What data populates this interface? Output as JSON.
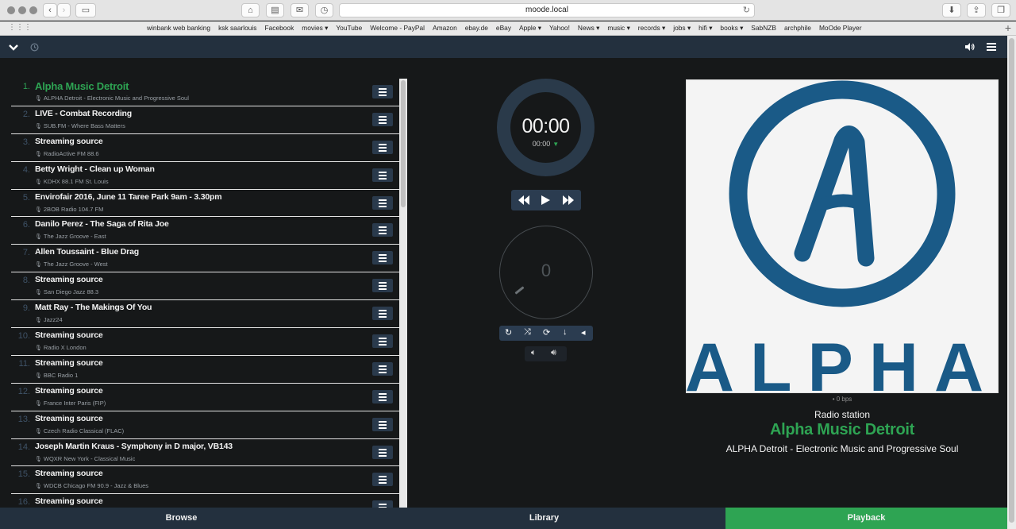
{
  "browser": {
    "url": "moode.local",
    "bookmarks": [
      "winbank web banking",
      "ksk saarlouis",
      "Facebook",
      "movies ▾",
      "YouTube",
      "Welcome - PayPal",
      "Amazon",
      "ebay.de",
      "eBay",
      "Apple ▾",
      "Yahoo!",
      "News ▾",
      "music ▾",
      "records ▾",
      "jobs ▾",
      "hifi ▾",
      "books ▾",
      "SabNZB",
      "archphile",
      "MoOde Player"
    ]
  },
  "playlist": [
    {
      "num": "1.",
      "title": "Alpha Music Detroit",
      "sub": "ALPHA Detroit - Electronic Music and Progressive Soul",
      "active": true
    },
    {
      "num": "2.",
      "title": "LIVE - Combat Recording",
      "sub": "SUB.FM - Where Bass Matters"
    },
    {
      "num": "3.",
      "title": "Streaming source",
      "sub": "RadioActive FM 88.6"
    },
    {
      "num": "4.",
      "title": "Betty Wright - Clean up Woman",
      "sub": "KDHX 88.1 FM St. Louis"
    },
    {
      "num": "5.",
      "title": "Envirofair 2016, June 11 Taree Park 9am - 3.30pm",
      "sub": "2BOB Radio 104.7 FM"
    },
    {
      "num": "6.",
      "title": "Danilo Perez - The Saga of Rita Joe",
      "sub": "The Jazz Groove - East"
    },
    {
      "num": "7.",
      "title": "Allen Toussaint - Blue Drag",
      "sub": "The Jazz Groove - West"
    },
    {
      "num": "8.",
      "title": "Streaming source",
      "sub": "San Diego Jazz 88.3"
    },
    {
      "num": "9.",
      "title": "Matt Ray - The Makings Of You",
      "sub": "Jazz24"
    },
    {
      "num": "10.",
      "title": "Streaming source",
      "sub": "Radio X London"
    },
    {
      "num": "11.",
      "title": "Streaming source",
      "sub": "BBC Radio 1"
    },
    {
      "num": "12.",
      "title": "Streaming source",
      "sub": "France Inter Paris (FIP)"
    },
    {
      "num": "13.",
      "title": "Streaming source",
      "sub": "Czech Radio Classical (FLAC)"
    },
    {
      "num": "14.",
      "title": "Joseph Martin Kraus - Symphony in D major, VB143",
      "sub": "WQXR New York - Classical Music"
    },
    {
      "num": "15.",
      "title": "Streaming source",
      "sub": "WDCB Chicago FM 90.9 - Jazz & Blues"
    },
    {
      "num": "16.",
      "title": "Streaming source",
      "sub": ""
    }
  ],
  "player": {
    "time": "00:00",
    "total": "00:00",
    "volume": "0"
  },
  "cover": {
    "logo_letter": "A",
    "logo_text": "ALPHA"
  },
  "now_playing": {
    "bitrate": "• 0 bps",
    "label": "Radio station",
    "station": "Alpha Music Detroit",
    "description": "ALPHA Detroit - Electronic Music and Progressive Soul"
  },
  "tabs": [
    {
      "label": "Browse"
    },
    {
      "label": "Library"
    },
    {
      "label": "Playback"
    }
  ],
  "colors": {
    "accent": "#2ea453",
    "nav": "#23303e",
    "logo_blue": "#1a5a87"
  }
}
